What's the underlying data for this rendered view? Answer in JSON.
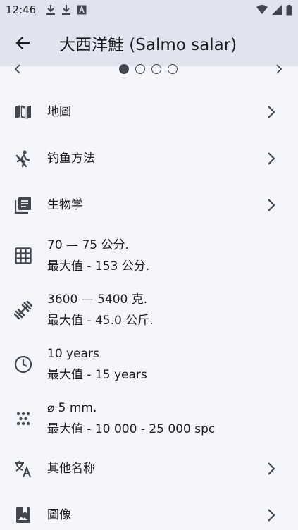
{
  "status_bar": {
    "time": "12:46"
  },
  "app_bar": {
    "title": "大西洋鮭 (Salmo salar)"
  },
  "carousel": {
    "dots": 4,
    "active_index": 0
  },
  "items": [
    {
      "label": "地圖",
      "icon": "map-icon"
    },
    {
      "label": "钓鱼方法",
      "icon": "fishing-icon"
    },
    {
      "label": "生物学",
      "icon": "library-books-icon"
    },
    {
      "line1": "70 — 75 公分.",
      "line2": "最大值 - 153 公分.",
      "icon": "grid-icon"
    },
    {
      "line1": "3600 — 5400 克.",
      "line2": "最大值 - 45.0 公斤.",
      "icon": "dumbbell-icon"
    },
    {
      "line1": "10 years",
      "line2": "最大值 - 15 years",
      "icon": "clock-icon"
    },
    {
      "line1": "⌀ 5 mm.",
      "line2": "最大值 - 10 000 - 25 000 spc",
      "icon": "eggs-icon"
    },
    {
      "label": "其他名称",
      "icon": "translate-icon"
    },
    {
      "label": "圖像",
      "icon": "photo-album-icon"
    }
  ]
}
